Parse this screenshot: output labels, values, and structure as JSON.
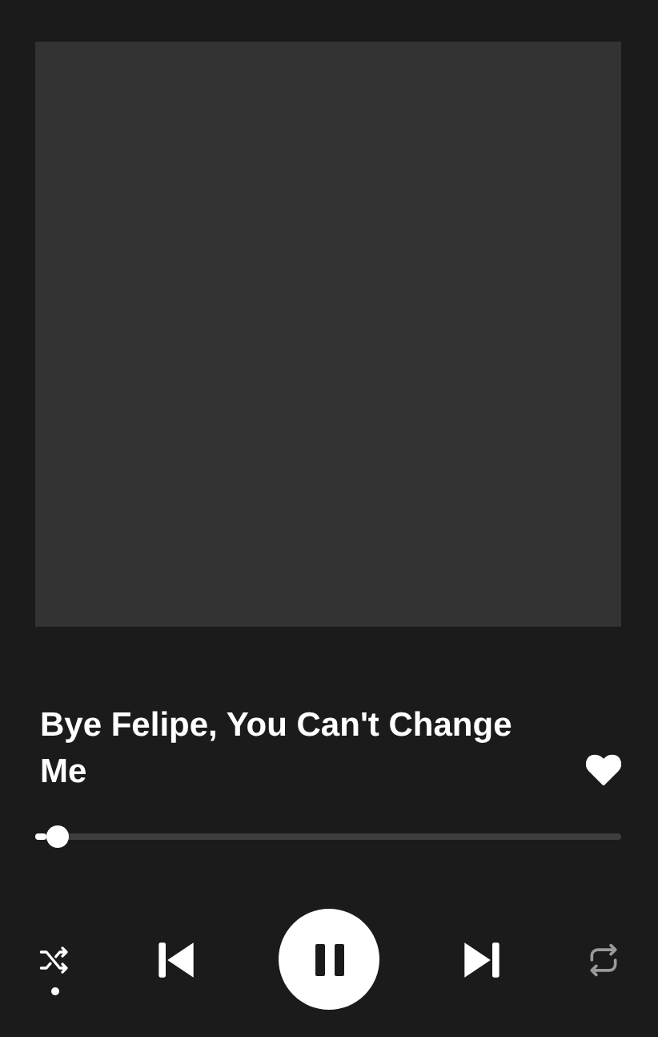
{
  "track": {
    "title": "Bye Felipe, You Can't Change Me",
    "liked": true
  },
  "progress": {
    "level": 0.02
  },
  "controls": {
    "shuffle": true,
    "playing": true,
    "repeat": false
  }
}
